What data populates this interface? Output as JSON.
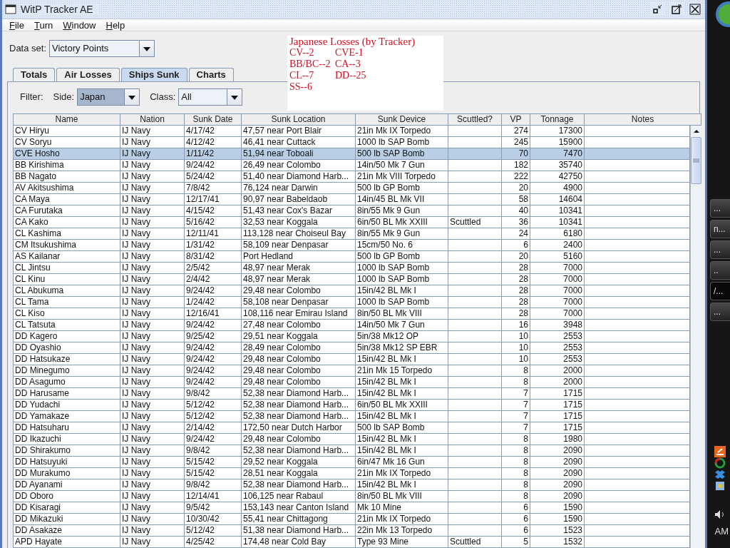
{
  "window": {
    "title": "WitP Tracker AE"
  },
  "menu": [
    {
      "label": "File"
    },
    {
      "label": "Turn"
    },
    {
      "label": "Window"
    },
    {
      "label": "Help"
    }
  ],
  "data_set": {
    "label": "Data set:",
    "value": "Victory Points"
  },
  "tabs": [
    {
      "label": "Totals",
      "selected": false
    },
    {
      "label": "Air Losses",
      "selected": false
    },
    {
      "label": "Ships Sunk",
      "selected": true
    },
    {
      "label": "Charts",
      "selected": false
    }
  ],
  "filter": {
    "label": "Filter:",
    "side": {
      "label": "Side:",
      "value": "Japan",
      "focused": true
    },
    "class": {
      "label": "Class:",
      "value": "All",
      "focused": false
    }
  },
  "table": {
    "columns": [
      "Name",
      "Nation",
      "Sunk Date",
      "Sunk Location",
      "Sunk Device",
      "Scuttled?",
      "VP",
      "Tonnage",
      "Notes"
    ],
    "rows": [
      {
        "name": "CV Hiryu",
        "nation": "IJ Navy",
        "date": "4/17/42",
        "location": "47,57 near Port Blair",
        "device": "21in Mk IX Torpedo",
        "vp": "274",
        "tonnage": "17300",
        "selected": false
      },
      {
        "name": "CV Soryu",
        "nation": "IJ Navy",
        "date": "4/12/42",
        "location": "46,41 near Cuttack",
        "device": "1000 lb SAP Bomb",
        "vp": "245",
        "tonnage": "15900",
        "selected": false
      },
      {
        "name": "CVE Hosho",
        "nation": "IJ Navy",
        "date": "1/11/42",
        "location": "51,94 near Toboali",
        "device": "500 lb SAP Bomb",
        "vp": "70",
        "tonnage": "7470",
        "selected": true
      },
      {
        "name": "BB Kirishima",
        "nation": "IJ Navy",
        "date": "9/24/42",
        "location": "26,49 near Colombo",
        "device": "14in/50 Mk 7 Gun",
        "vp": "182",
        "tonnage": "35740",
        "selected": false
      },
      {
        "name": "BB Nagato",
        "nation": "IJ Navy",
        "date": "5/24/42",
        "location": "51,40 near Diamond Harb...",
        "device": "21in Mk VIII Torpedo",
        "vp": "222",
        "tonnage": "42750",
        "selected": false
      },
      {
        "name": "AV Akitsushima",
        "nation": "IJ Navy",
        "date": "7/8/42",
        "location": "76,124 near Darwin",
        "device": "500 lb GP Bomb",
        "vp": "20",
        "tonnage": "4900",
        "selected": false
      },
      {
        "name": "CA Maya",
        "nation": "IJ Navy",
        "date": "12/17/41",
        "location": "90,97 near Babeldaob",
        "device": "14in/45 BL Mk VII",
        "vp": "58",
        "tonnage": "14604",
        "selected": false
      },
      {
        "name": "CA Furutaka",
        "nation": "IJ Navy",
        "date": "4/15/42",
        "location": "51,43 near Cox's Bazar",
        "device": "8in/55 Mk 9 Gun",
        "vp": "40",
        "tonnage": "10341",
        "selected": false
      },
      {
        "name": "CA Kako",
        "nation": "IJ Navy",
        "date": "5/16/42",
        "location": "32,53 near Koggala",
        "device": "6in/50 BL Mk XXIII",
        "scuttled": "Scuttled",
        "vp": "36",
        "tonnage": "10341",
        "selected": false
      },
      {
        "name": "CL Kashima",
        "nation": "IJ Navy",
        "date": "12/11/41",
        "location": "113,128 near Choiseul Bay",
        "device": "8in/55 Mk 9 Gun",
        "vp": "24",
        "tonnage": "6180",
        "selected": false
      },
      {
        "name": "CM Itsukushima",
        "nation": "IJ Navy",
        "date": "1/31/42",
        "location": "58,109 near Denpasar",
        "device": "15cm/50 No. 6",
        "vp": "6",
        "tonnage": "2400",
        "selected": false
      },
      {
        "name": "AS Kailanar",
        "nation": "IJ Navy",
        "date": "8/31/42",
        "location": "Port Hedland",
        "device": "500 lb GP Bomb",
        "vp": "20",
        "tonnage": "5160",
        "selected": false
      },
      {
        "name": "CL Jintsu",
        "nation": "IJ Navy",
        "date": "2/5/42",
        "location": "48,97 near Merak",
        "device": "1000 lb SAP Bomb",
        "vp": "28",
        "tonnage": "7000",
        "selected": false
      },
      {
        "name": "CL Kinu",
        "nation": "IJ Navy",
        "date": "2/4/42",
        "location": "48,97 near Merak",
        "device": "1000 lb SAP Bomb",
        "vp": "28",
        "tonnage": "7000",
        "selected": false
      },
      {
        "name": "CL Abukuma",
        "nation": "IJ Navy",
        "date": "9/24/42",
        "location": "29,48 near Colombo",
        "device": "15in/42 BL Mk I",
        "vp": "28",
        "tonnage": "7000",
        "selected": false
      },
      {
        "name": "CL Tama",
        "nation": "IJ Navy",
        "date": "1/24/42",
        "location": "58,108 near Denpasar",
        "device": "1000 lb SAP Bomb",
        "vp": "28",
        "tonnage": "7000",
        "selected": false
      },
      {
        "name": "CL Kiso",
        "nation": "IJ Navy",
        "date": "12/16/41",
        "location": "108,116 near Emirau Island",
        "device": "8in/50 BL Mk VIII",
        "vp": "28",
        "tonnage": "7000",
        "selected": false
      },
      {
        "name": "CL Tatsuta",
        "nation": "IJ Navy",
        "date": "9/24/42",
        "location": "27,48 near Colombo",
        "device": "14in/50 Mk 7 Gun",
        "vp": "16",
        "tonnage": "3948",
        "selected": false
      },
      {
        "name": "DD Kagero",
        "nation": "IJ Navy",
        "date": "9/25/42",
        "location": "29,51 near Koggala",
        "device": "5in/38 Mk12 OP",
        "vp": "10",
        "tonnage": "2553",
        "selected": false
      },
      {
        "name": "DD Oyashio",
        "nation": "IJ Navy",
        "date": "9/24/42",
        "location": "28,49 near Colombo",
        "device": "5in/38 Mk12 SP EBR",
        "vp": "10",
        "tonnage": "2553",
        "selected": false
      },
      {
        "name": "DD Hatsukaze",
        "nation": "IJ Navy",
        "date": "9/24/42",
        "location": "29,48 near Colombo",
        "device": "15in/42 BL Mk I",
        "vp": "10",
        "tonnage": "2553",
        "selected": false
      },
      {
        "name": "DD Minegumo",
        "nation": "IJ Navy",
        "date": "9/24/42",
        "location": "29,48 near Colombo",
        "device": "21in Mk 15 Torpedo",
        "vp": "8",
        "tonnage": "2000",
        "selected": false
      },
      {
        "name": "DD Asagumo",
        "nation": "IJ Navy",
        "date": "9/24/42",
        "location": "29,48 near Colombo",
        "device": "15in/42 BL Mk I",
        "vp": "8",
        "tonnage": "2000",
        "selected": false
      },
      {
        "name": "DD Harusame",
        "nation": "IJ Navy",
        "date": "9/8/42",
        "location": "52,38 near Diamond Harb...",
        "device": "15in/42 BL Mk I",
        "vp": "7",
        "tonnage": "1715",
        "selected": false
      },
      {
        "name": "DD Yudachi",
        "nation": "IJ Navy",
        "date": "5/12/42",
        "location": "52,38 near Diamond Harb...",
        "device": "6in/50 BL Mk XXIII",
        "vp": "7",
        "tonnage": "1715",
        "selected": false
      },
      {
        "name": "DD Yamakaze",
        "nation": "IJ Navy",
        "date": "5/12/42",
        "location": "52,38 near Diamond Harb...",
        "device": "15in/42 BL Mk I",
        "vp": "7",
        "tonnage": "1715",
        "selected": false
      },
      {
        "name": "DD Hatsuharu",
        "nation": "IJ Navy",
        "date": "2/14/42",
        "location": "172,50 near Dutch Harbor",
        "device": "500 lb SAP Bomb",
        "vp": "7",
        "tonnage": "1715",
        "selected": false
      },
      {
        "name": "DD Ikazuchi",
        "nation": "IJ Navy",
        "date": "9/24/42",
        "location": "29,48 near Colombo",
        "device": "15in/42 BL Mk I",
        "vp": "8",
        "tonnage": "1980",
        "selected": false
      },
      {
        "name": "DD Shirakumo",
        "nation": "IJ Navy",
        "date": "9/8/42",
        "location": "52,38 near Diamond Harb...",
        "device": "15in/42 BL Mk I",
        "vp": "8",
        "tonnage": "2090",
        "selected": false
      },
      {
        "name": "DD Hatsuyuki",
        "nation": "IJ Navy",
        "date": "5/15/42",
        "location": "29,52 near Koggala",
        "device": "6in/47 Mk 16 Gun",
        "vp": "8",
        "tonnage": "2090",
        "selected": false
      },
      {
        "name": "DD Murakumo",
        "nation": "IJ Navy",
        "date": "5/15/42",
        "location": "28,51 near Koggala",
        "device": "21in Mk IX Torpedo",
        "vp": "8",
        "tonnage": "2090",
        "selected": false
      },
      {
        "name": "DD Ayanami",
        "nation": "IJ Navy",
        "date": "9/8/42",
        "location": "52,38 near Diamond Harb...",
        "device": "15in/42 BL Mk I",
        "vp": "8",
        "tonnage": "2090",
        "selected": false
      },
      {
        "name": "DD Oboro",
        "nation": "IJ Navy",
        "date": "12/14/41",
        "location": "106,125 near Rabaul",
        "device": "8in/50 BL Mk VIII",
        "vp": "8",
        "tonnage": "2090",
        "selected": false
      },
      {
        "name": "DD Kisaragi",
        "nation": "IJ Navy",
        "date": "9/5/42",
        "location": "153,143 near Canton Island",
        "device": "Mk 10 Mine",
        "vp": "6",
        "tonnage": "1590",
        "selected": false
      },
      {
        "name": "DD Mikazuki",
        "nation": "IJ Navy",
        "date": "10/30/42",
        "location": "55,41 near Chittagong",
        "device": "21in Mk IX Torpedo",
        "vp": "6",
        "tonnage": "1590",
        "selected": false
      },
      {
        "name": "DD Asakaze",
        "nation": "IJ Navy",
        "date": "5/12/42",
        "location": "51,38 near Diamond Harb...",
        "device": "22in Mk 13 Torpedo",
        "vp": "6",
        "tonnage": "1523",
        "selected": false
      },
      {
        "name": "APD Hayate",
        "nation": "IJ Navy",
        "date": "4/25/42",
        "location": "174,48 near Cold Bay",
        "device": "Type 93 Mine",
        "scuttled": "Scuttled",
        "vp": "5",
        "tonnage": "1532",
        "selected": false
      }
    ]
  },
  "annotation": {
    "title": "Japanese Losses (by Tracker)",
    "items": [
      "CV--2",
      "CVE-1",
      "BB/BC--2",
      "CA--3",
      "CL--7",
      "DD--25",
      "SS--6"
    ]
  },
  "taskbar": {
    "buttons": [
      {
        "label": "...",
        "selected": false
      },
      {
        "label": "n...",
        "selected": false
      },
      {
        "label": "...",
        "selected": false
      },
      {
        "label": "..",
        "selected": false
      },
      {
        "label": "/...",
        "selected": true
      },
      {
        "label": "...",
        "selected": false
      }
    ],
    "clock": "AM"
  }
}
